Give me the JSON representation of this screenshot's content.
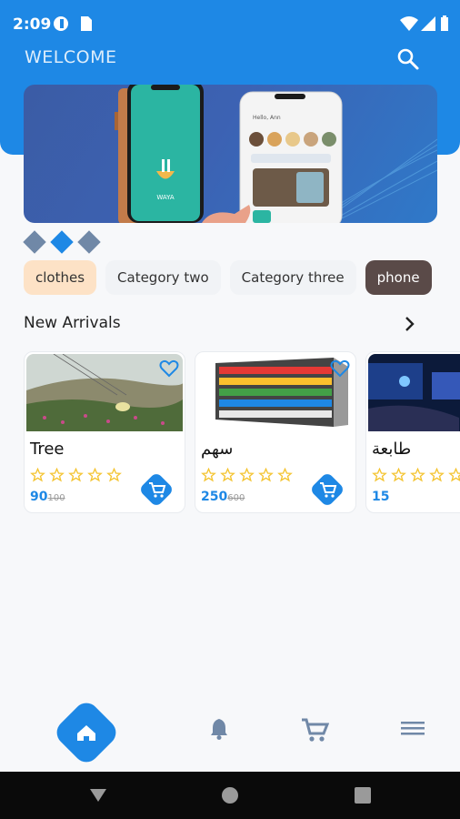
{
  "status_bar": {
    "time": "2:09"
  },
  "header": {
    "title": "WELCOME"
  },
  "banner": {
    "mock_greeting": "Hello, Ann",
    "app_caption": "WAYA"
  },
  "carousel": {
    "count": 3,
    "active_index": 1
  },
  "categories": [
    {
      "label": "clothes"
    },
    {
      "label": "Category two"
    },
    {
      "label": "Category three"
    },
    {
      "label": "phone"
    }
  ],
  "section": {
    "title": "New Arrivals"
  },
  "products": [
    {
      "name": "Tree",
      "price": "90",
      "old_price": "100",
      "rating": 0
    },
    {
      "name": "سهم",
      "price": "250",
      "old_price": "600",
      "rating": 0
    },
    {
      "name": "طابعة",
      "price": "15",
      "old_price": "",
      "rating": 0
    }
  ],
  "colors": {
    "primary": "#1e88e5",
    "chip_active": "#fde2c6",
    "star": "#f4c430"
  },
  "icons": [
    "wifi-icon",
    "signal-icon",
    "battery-icon",
    "search-icon",
    "heart-icon",
    "star-icon",
    "cart-icon",
    "home-icon",
    "bell-icon",
    "menu-icon"
  ]
}
